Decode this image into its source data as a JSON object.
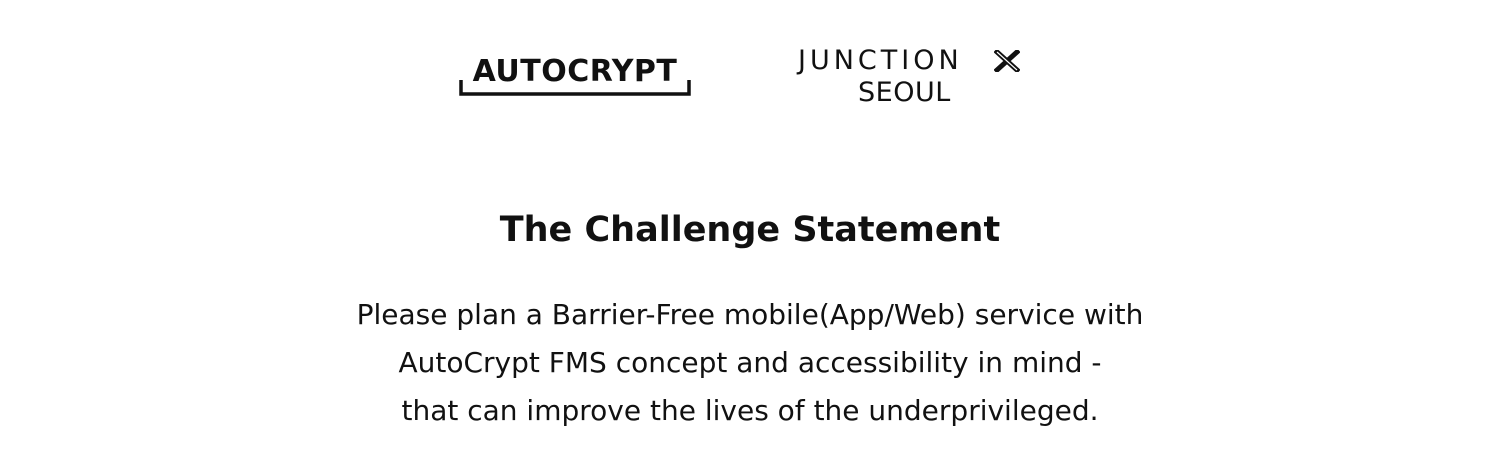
{
  "logos": {
    "autocrypt": {
      "wordmark": "AUTOCRYPT"
    },
    "junction": {
      "line1": "JUNCTION",
      "line2": "SEOUL",
      "mark_icon": "x-mark-icon"
    }
  },
  "heading": {
    "title": "The Challenge Statement"
  },
  "statement": {
    "lines": [
      "Please plan a Barrier-Free mobile(App/Web) service with",
      "AutoCrypt FMS concept and accessibility in mind -",
      "that can improve the lives of the underprivileged."
    ]
  },
  "colors": {
    "background": "#ffffff",
    "text": "#111111"
  }
}
